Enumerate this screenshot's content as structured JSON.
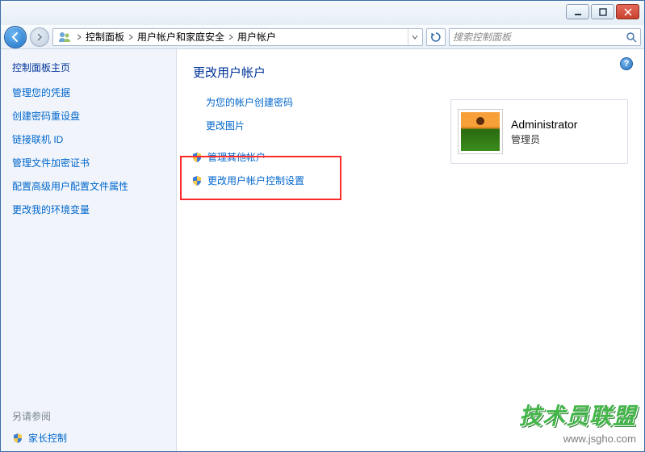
{
  "titlebar": {
    "min": "minimize",
    "max": "maximize",
    "close": "close"
  },
  "breadcrumb": {
    "items": [
      "控制面板",
      "用户帐户和家庭安全",
      "用户帐户"
    ]
  },
  "search": {
    "placeholder": "搜索控制面板"
  },
  "sidebar": {
    "title": "控制面板主页",
    "links": [
      "管理您的凭据",
      "创建密码重设盘",
      "链接联机 ID",
      "管理文件加密证书",
      "配置高级用户配置文件属性",
      "更改我的环境变量"
    ],
    "see_also": "另请参阅",
    "footer_link": "家长控制"
  },
  "main": {
    "heading": "更改用户帐户",
    "links": [
      {
        "label": "为您的帐户创建密码",
        "shield": false
      },
      {
        "label": "更改图片",
        "shield": false
      },
      {
        "label": "管理其他帐户",
        "shield": true
      },
      {
        "label": "更改用户帐户控制设置",
        "shield": true
      }
    ]
  },
  "user": {
    "name": "Administrator",
    "role": "管理员"
  },
  "watermark": {
    "logo": "技术员联盟",
    "url": "www.jsgho.com"
  }
}
